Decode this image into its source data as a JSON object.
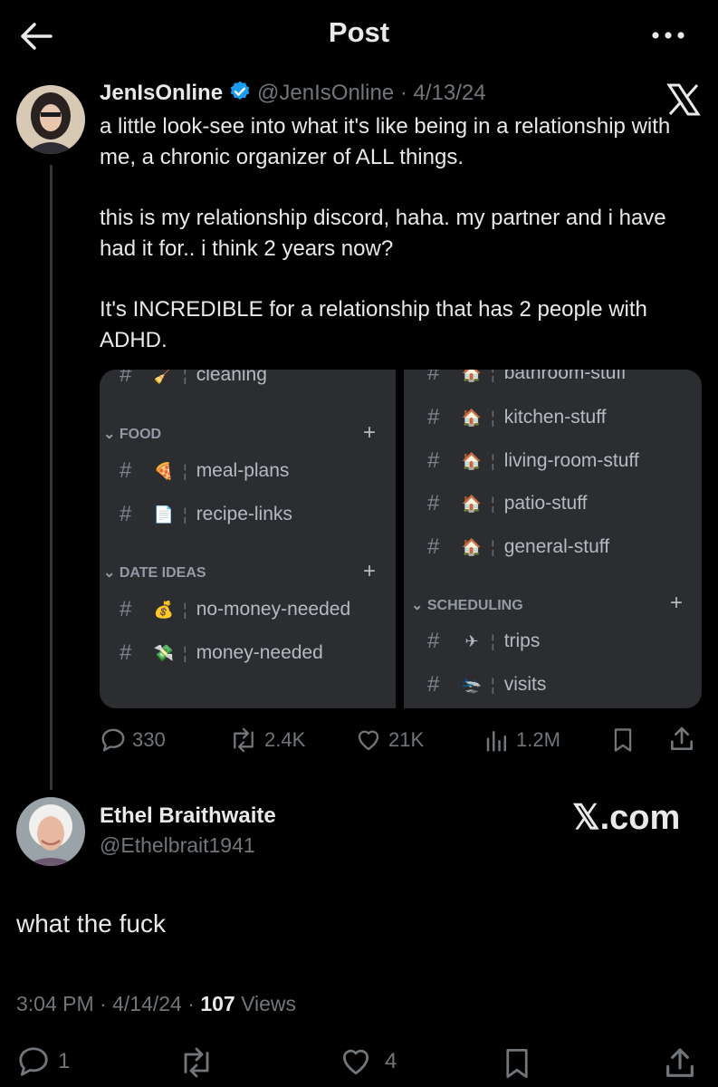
{
  "header": {
    "title": "Post",
    "back_icon": "arrow-left-icon",
    "more_icon": "more-dots-icon"
  },
  "tweet": {
    "name": "JenIsOnline",
    "handle": "@JenIsOnline",
    "date": "4/13/24",
    "separator": "·",
    "body": [
      "a little look-see into what it's like being in a relationship with me, a chronic organizer of ALL things.",
      "this is my relationship discord, haha. my partner and i have had it for.. i think 2 years now?",
      "It's INCREDIBLE for a relationship that has 2 people with ADHD."
    ],
    "accent": "#1d9bf0",
    "media": {
      "left": {
        "top_channel": "cleaning",
        "categories": [
          {
            "label": "FOOD",
            "channels": [
              {
                "name": "meal-plans",
                "emoji": "🍕"
              },
              {
                "name": "recipe-links",
                "emoji": "📄"
              }
            ]
          },
          {
            "label": "DATE IDEAS",
            "channels": [
              {
                "name": "no-money-needed",
                "emoji": "💰"
              },
              {
                "name": "money-needed",
                "emoji": "💸"
              }
            ]
          }
        ]
      },
      "right": {
        "top_channel": "bathroom-stuff",
        "channels": [
          {
            "name": "kitchen-stuff",
            "emoji": "🏠"
          },
          {
            "name": "living-room-stuff",
            "emoji": "🏠"
          },
          {
            "name": "patio-stuff",
            "emoji": "🏠"
          },
          {
            "name": "general-stuff",
            "emoji": "🏠"
          }
        ],
        "category": {
          "label": "SCHEDULING",
          "channels": [
            {
              "name": "trips",
              "emoji": "✈"
            },
            {
              "name": "visits",
              "emoji": "🛬"
            }
          ]
        }
      },
      "hash": "#",
      "plus": "+",
      "sep": "¦"
    },
    "stats": {
      "replies": "330",
      "reposts": "2.4K",
      "likes": "21K",
      "views": "1.2M"
    }
  },
  "reply": {
    "name": "Ethel Braithwaite",
    "handle": "@Ethelbrait1941",
    "brand": "𝕏.com",
    "text": "what the fuck",
    "time": "3:04 PM",
    "date": "4/14/24",
    "views_count": "107",
    "views_label": "Views",
    "separator": "·",
    "replies": "1",
    "likes": "4"
  }
}
